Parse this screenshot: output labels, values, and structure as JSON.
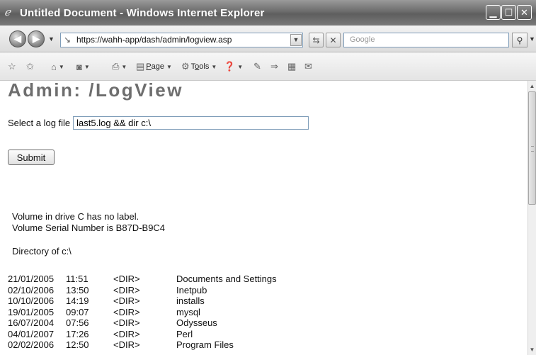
{
  "window": {
    "title": "Untitled Document - Windows Internet Explorer",
    "controls": {
      "minimize": "▁",
      "maximize": "☐",
      "close": "✕"
    }
  },
  "addressbar": {
    "url": "https://wahh-app/dash/admin/logview.asp",
    "search_placeholder": "Google"
  },
  "toolbar": {
    "page_label_u": "P",
    "page_label_rest": "age",
    "tools_label_pre": "T",
    "tools_label_u": "o",
    "tools_label_rest": "ols"
  },
  "page": {
    "heading": "Admin: /LogView",
    "form_label": "Select a log file",
    "log_input_value": "last5.log && dir c:\\",
    "submit_label": "Submit"
  },
  "output": {
    "volume_label_line": "Volume in drive C has no label.",
    "serial_line": "Volume Serial Number is B87D-B9C4",
    "directory_line": "Directory of c:\\",
    "entries": [
      {
        "date": "21/01/2005",
        "time": "11:51",
        "type": "<DIR>",
        "name": "Documents and Settings"
      },
      {
        "date": "02/10/2006",
        "time": "13:50",
        "type": "<DIR>",
        "name": "Inetpub"
      },
      {
        "date": "10/10/2006",
        "time": "14:19",
        "type": "<DIR>",
        "name": "installs"
      },
      {
        "date": "19/01/2005",
        "time": "09:07",
        "type": "<DIR>",
        "name": "mysql"
      },
      {
        "date": "16/07/2004",
        "time": "07:56",
        "type": "<DIR>",
        "name": "Odysseus"
      },
      {
        "date": "04/01/2007",
        "time": "17:26",
        "type": "<DIR>",
        "name": "Perl"
      },
      {
        "date": "02/02/2006",
        "time": "12:50",
        "type": "<DIR>",
        "name": "Program Files"
      }
    ]
  }
}
